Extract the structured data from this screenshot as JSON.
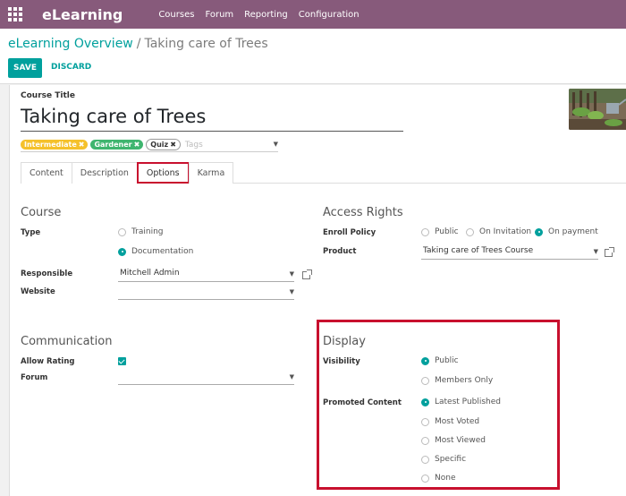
{
  "app": {
    "name": "eLearning"
  },
  "menu": {
    "items": [
      "Courses",
      "Forum",
      "Reporting",
      "Configuration"
    ]
  },
  "breadcrumb": {
    "parent": "eLearning Overview",
    "separator": "/",
    "current": "Taking care of Trees"
  },
  "actions": {
    "save": "SAVE",
    "discard": "DISCARD"
  },
  "course": {
    "title_label": "Course Title",
    "title": "Taking care of Trees",
    "tags": [
      {
        "label": "Intermediate",
        "color": "#f5c12b"
      },
      {
        "label": "Gardener",
        "color": "#3fb56f"
      },
      {
        "label": "Quiz",
        "color": "#ffffff"
      }
    ],
    "tags_placeholder": "Tags",
    "remove_glyph": "✖"
  },
  "tabs": [
    {
      "label": "Content",
      "active": false
    },
    {
      "label": "Description",
      "active": false
    },
    {
      "label": "Options",
      "active": true
    },
    {
      "label": "Karma",
      "active": false
    }
  ],
  "course_group": {
    "title": "Course",
    "type_label": "Type",
    "type_options": [
      {
        "label": "Training",
        "checked": false
      },
      {
        "label": "Documentation",
        "checked": true
      }
    ],
    "responsible_label": "Responsible",
    "responsible_value": "Mitchell Admin",
    "website_label": "Website",
    "website_value": ""
  },
  "access_group": {
    "title": "Access Rights",
    "enroll_label": "Enroll Policy",
    "enroll_options": [
      {
        "label": "Public",
        "checked": false
      },
      {
        "label": "On Invitation",
        "checked": false
      },
      {
        "label": "On payment",
        "checked": true
      }
    ],
    "product_label": "Product",
    "product_value": "Taking care of Trees Course"
  },
  "communication_group": {
    "title": "Communication",
    "allow_rating_label": "Allow Rating",
    "allow_rating_checked": true,
    "forum_label": "Forum",
    "forum_value": ""
  },
  "display_group": {
    "title": "Display",
    "visibility_label": "Visibility",
    "visibility_options": [
      {
        "label": "Public",
        "checked": true
      },
      {
        "label": "Members Only",
        "checked": false
      }
    ],
    "promoted_label": "Promoted Content",
    "promoted_options": [
      {
        "label": "Latest Published",
        "checked": true
      },
      {
        "label": "Most Voted",
        "checked": false
      },
      {
        "label": "Most Viewed",
        "checked": false
      },
      {
        "label": "Specific",
        "checked": false
      },
      {
        "label": "None",
        "checked": false
      }
    ]
  },
  "colors": {
    "brand": "#875a7b",
    "accent": "#00a09d",
    "highlight": "#c8102e"
  }
}
